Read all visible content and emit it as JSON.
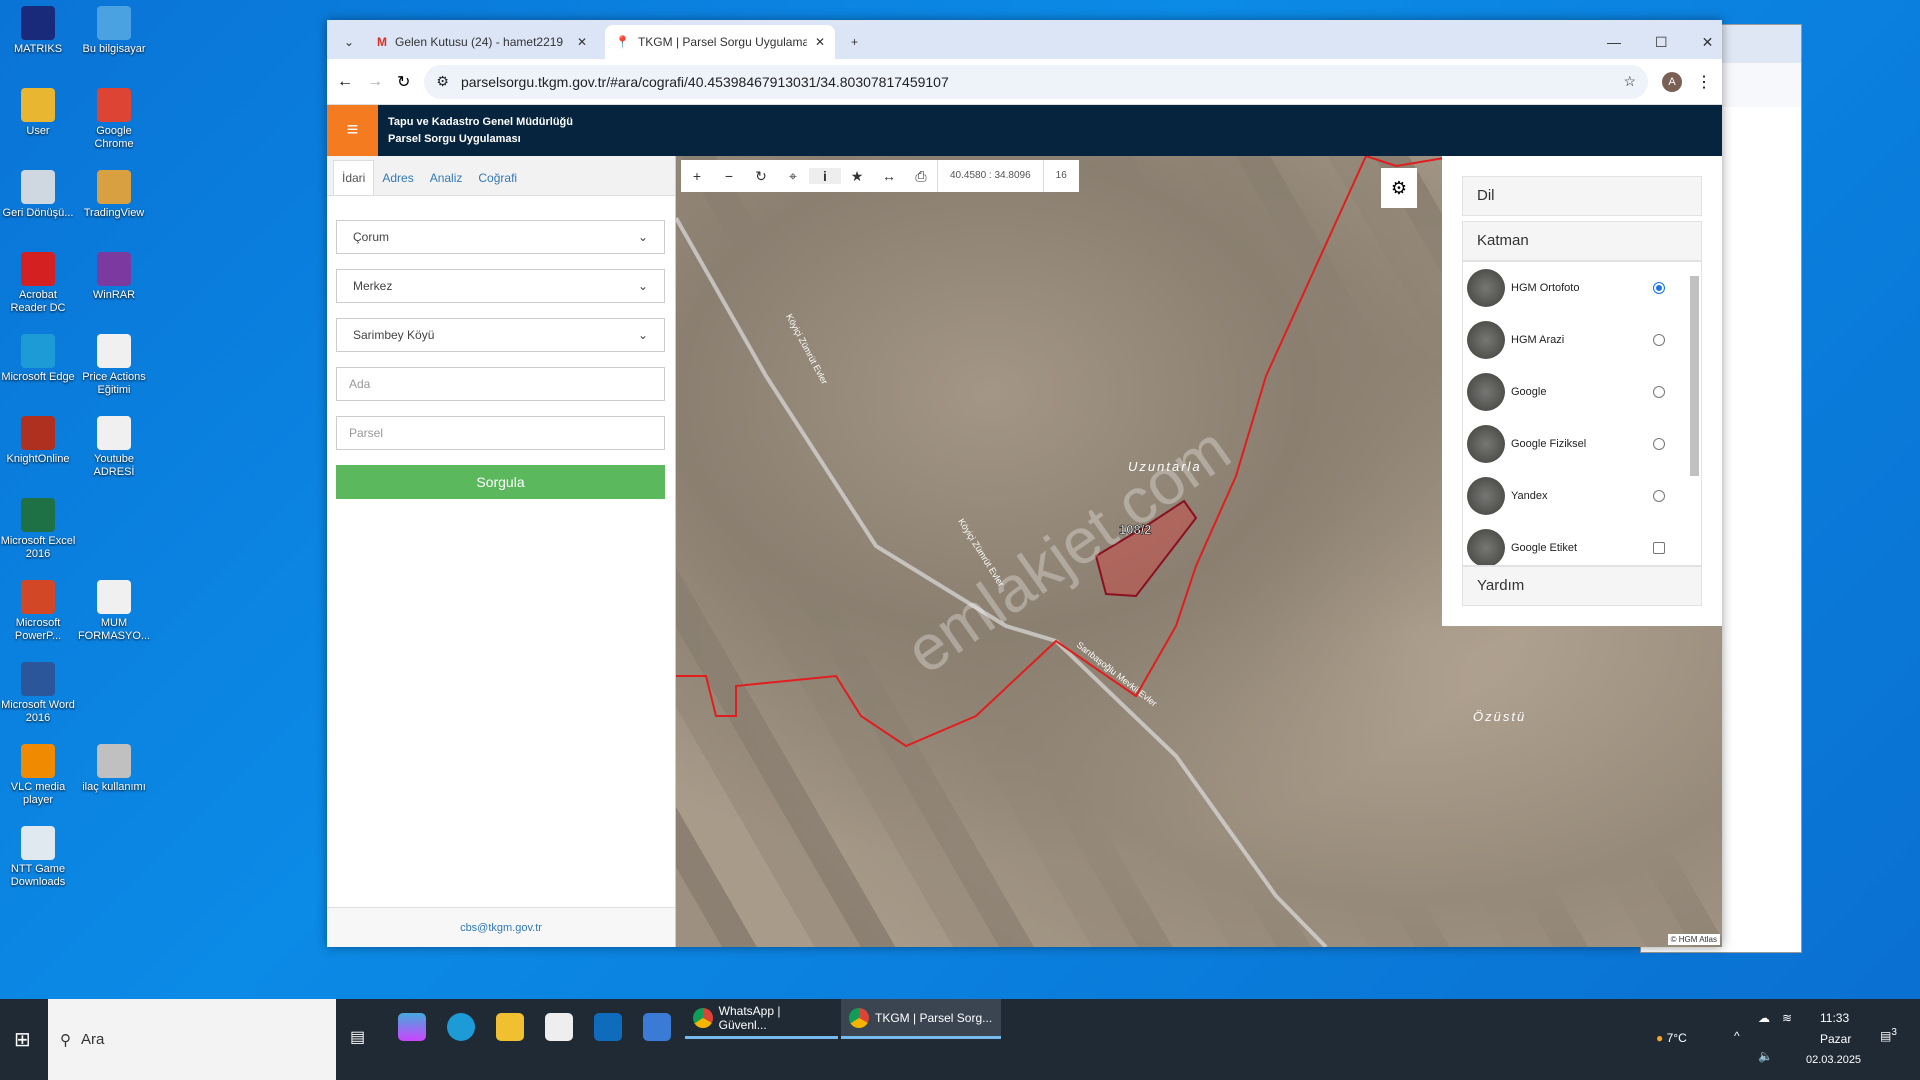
{
  "desktop_icons": [
    {
      "label": "MATRIKS",
      "color": "#1a2a7a"
    },
    {
      "label": "Bu bilgisayar",
      "color": "#4aa3e0"
    },
    {
      "label": "User",
      "color": "#e8b630"
    },
    {
      "label": "Google Chrome",
      "color": "#dd4433"
    },
    {
      "label": "Geri Dönüşü...",
      "color": "#cfd8e0"
    },
    {
      "label": "TradingView",
      "color": "#d8a040"
    },
    {
      "label": "Acrobat Reader DC",
      "color": "#d42020"
    },
    {
      "label": "WinRAR",
      "color": "#7a3aa0"
    },
    {
      "label": "Microsoft Edge",
      "color": "#1c9bd6"
    },
    {
      "label": "Price Actions Eğitimi",
      "color": "#f0f0f0"
    },
    {
      "label": "KnightOnline",
      "color": "#b03020"
    },
    {
      "label": "Youtube ADRESİ",
      "color": "#f0f0f0"
    },
    {
      "label": "Microsoft Excel 2016",
      "color": "#1e7145"
    },
    {
      "label": "Microsoft PowerP...",
      "color": "#d24726"
    },
    {
      "label": "MUM FORMASYO...",
      "color": "#f0f0f0"
    },
    {
      "label": "Microsoft Word 2016",
      "color": "#2b579a"
    },
    {
      "label": "VLC media player",
      "color": "#f08a00"
    },
    {
      "label": "ilaç kullanımı",
      "color": "#c0c0c0"
    },
    {
      "label": "NTT Game Downloads",
      "color": "#e0e8f0"
    }
  ],
  "browser": {
    "tabs": [
      {
        "title": "Gelen Kutusu (24) - hamet2219",
        "icon": "gmail-icon"
      },
      {
        "title": "TKGM | Parsel Sorgu Uygulaması",
        "icon": "location-pin-icon"
      }
    ],
    "url": "parselsorgu.tkgm.gov.tr/#ara/cografi/40.45398467913031/34.80307817459107",
    "profile": "A"
  },
  "app": {
    "org": "Tapu ve Kadastro Genel Müdürlüğü",
    "name": "Parsel Sorgu Uygulaması",
    "accent": "#f47b20",
    "header_bg": "#06243d"
  },
  "search_panel": {
    "tabs": [
      "İdari",
      "Adres",
      "Analiz",
      "Coğrafi"
    ],
    "active_tab": "İdari",
    "il": "Çorum",
    "ilce": "Merkez",
    "mahalle": "Sarimbey Köyü",
    "ada_placeholder": "Ada",
    "parsel_placeholder": "Parsel",
    "submit": "Sorgula",
    "footer_email": "cbs@tkgm.gov.tr"
  },
  "map": {
    "coords": "40.4580 : 34.8096",
    "zoom": "16",
    "labels": {
      "place1": "Uzuntarla",
      "place2": "Özüstü",
      "parcel": "108/2",
      "road1": "Köyiçi Zümrüt Evler",
      "road2": "Köyiçi Zümrüt Evler",
      "road3": "Sarıbaşoğlu Mevkii Evler"
    },
    "watermark": "emlakjet.com",
    "attribution": "© HGM Atlas"
  },
  "right_panel": {
    "sections": [
      "Dil",
      "Katman",
      "Yardım"
    ],
    "layers": [
      {
        "name": "HGM Ortofoto",
        "type": "radio",
        "selected": true
      },
      {
        "name": "HGM Arazi",
        "type": "radio",
        "selected": false
      },
      {
        "name": "Google",
        "type": "radio",
        "selected": false
      },
      {
        "name": "Google Fiziksel",
        "type": "radio",
        "selected": false
      },
      {
        "name": "Yandex",
        "type": "radio",
        "selected": false
      },
      {
        "name": "Google Etiket",
        "type": "checkbox",
        "selected": false
      }
    ]
  },
  "taskbar": {
    "search": "Ara",
    "apps": [
      {
        "label": "WhatsApp | Güvenl..."
      },
      {
        "label": "TKGM | Parsel Sorg..."
      }
    ],
    "weather": "7°C",
    "time": "11:33",
    "day": "Pazar",
    "date": "02.03.2025",
    "notifications": "3"
  }
}
